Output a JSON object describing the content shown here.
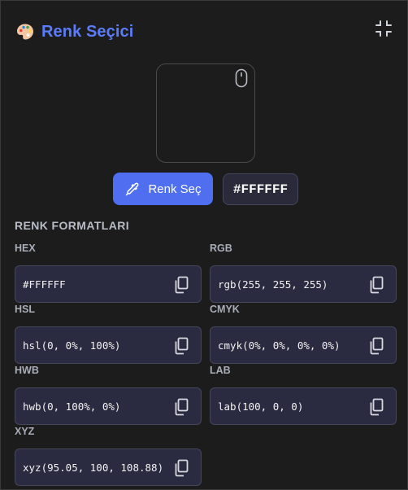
{
  "header": {
    "title": "Renk Seçici",
    "logo_icon": "palette-icon",
    "action_icon": "collapse-icon"
  },
  "preview": {
    "icon": "mouse-icon"
  },
  "pick_button": {
    "label": "Renk Seç",
    "icon": "eyedropper-icon"
  },
  "current_hex": "#FFFFFF",
  "section_title": "RENK FORMATLARI",
  "formats": [
    {
      "label": "HEX",
      "value": "#FFFFFF"
    },
    {
      "label": "RGB",
      "value": "rgb(255, 255, 255)"
    },
    {
      "label": "HSL",
      "value": "hsl(0, 0%, 100%)"
    },
    {
      "label": "CMYK",
      "value": "cmyk(0%, 0%, 0%, 0%)"
    },
    {
      "label": "HWB",
      "value": "hwb(0, 100%, 0%)"
    },
    {
      "label": "LAB",
      "value": "lab(100, 0, 0)"
    },
    {
      "label": "XYZ",
      "value": "xyz(95.05, 100, 108.88)"
    }
  ],
  "colors": {
    "accent": "#4f6ef0",
    "title": "#5b7cfa",
    "background": "#1c1c1c"
  }
}
